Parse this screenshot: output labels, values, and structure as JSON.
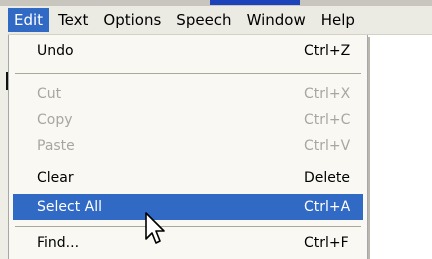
{
  "menubar": {
    "items": [
      {
        "label": "Edit"
      },
      {
        "label": "Text"
      },
      {
        "label": "Options"
      },
      {
        "label": "Speech"
      },
      {
        "label": "Window"
      },
      {
        "label": "Help"
      }
    ],
    "active_item": "Edit"
  },
  "edit_menu": {
    "items": [
      {
        "label": "Undo",
        "shortcut": "Ctrl+Z",
        "state": "enabled"
      },
      {
        "label": "Cut",
        "shortcut": "Ctrl+X",
        "state": "disabled"
      },
      {
        "label": "Copy",
        "shortcut": "Ctrl+C",
        "state": "disabled"
      },
      {
        "label": "Paste",
        "shortcut": "Ctrl+V",
        "state": "disabled"
      },
      {
        "label": "Clear",
        "shortcut": "Delete",
        "state": "enabled"
      },
      {
        "label": "Select All",
        "shortcut": "Ctrl+A",
        "state": "highlighted"
      },
      {
        "label": "Find...",
        "shortcut": "Ctrl+F",
        "state": "enabled"
      }
    ]
  },
  "colors": {
    "highlight": "#316ac5",
    "menubar_bg": "#ecebe3",
    "menu_bg": "#f9f8f3",
    "disabled_text": "#a8a69f"
  },
  "icons": {
    "pointer": "arrow-cursor-icon"
  }
}
